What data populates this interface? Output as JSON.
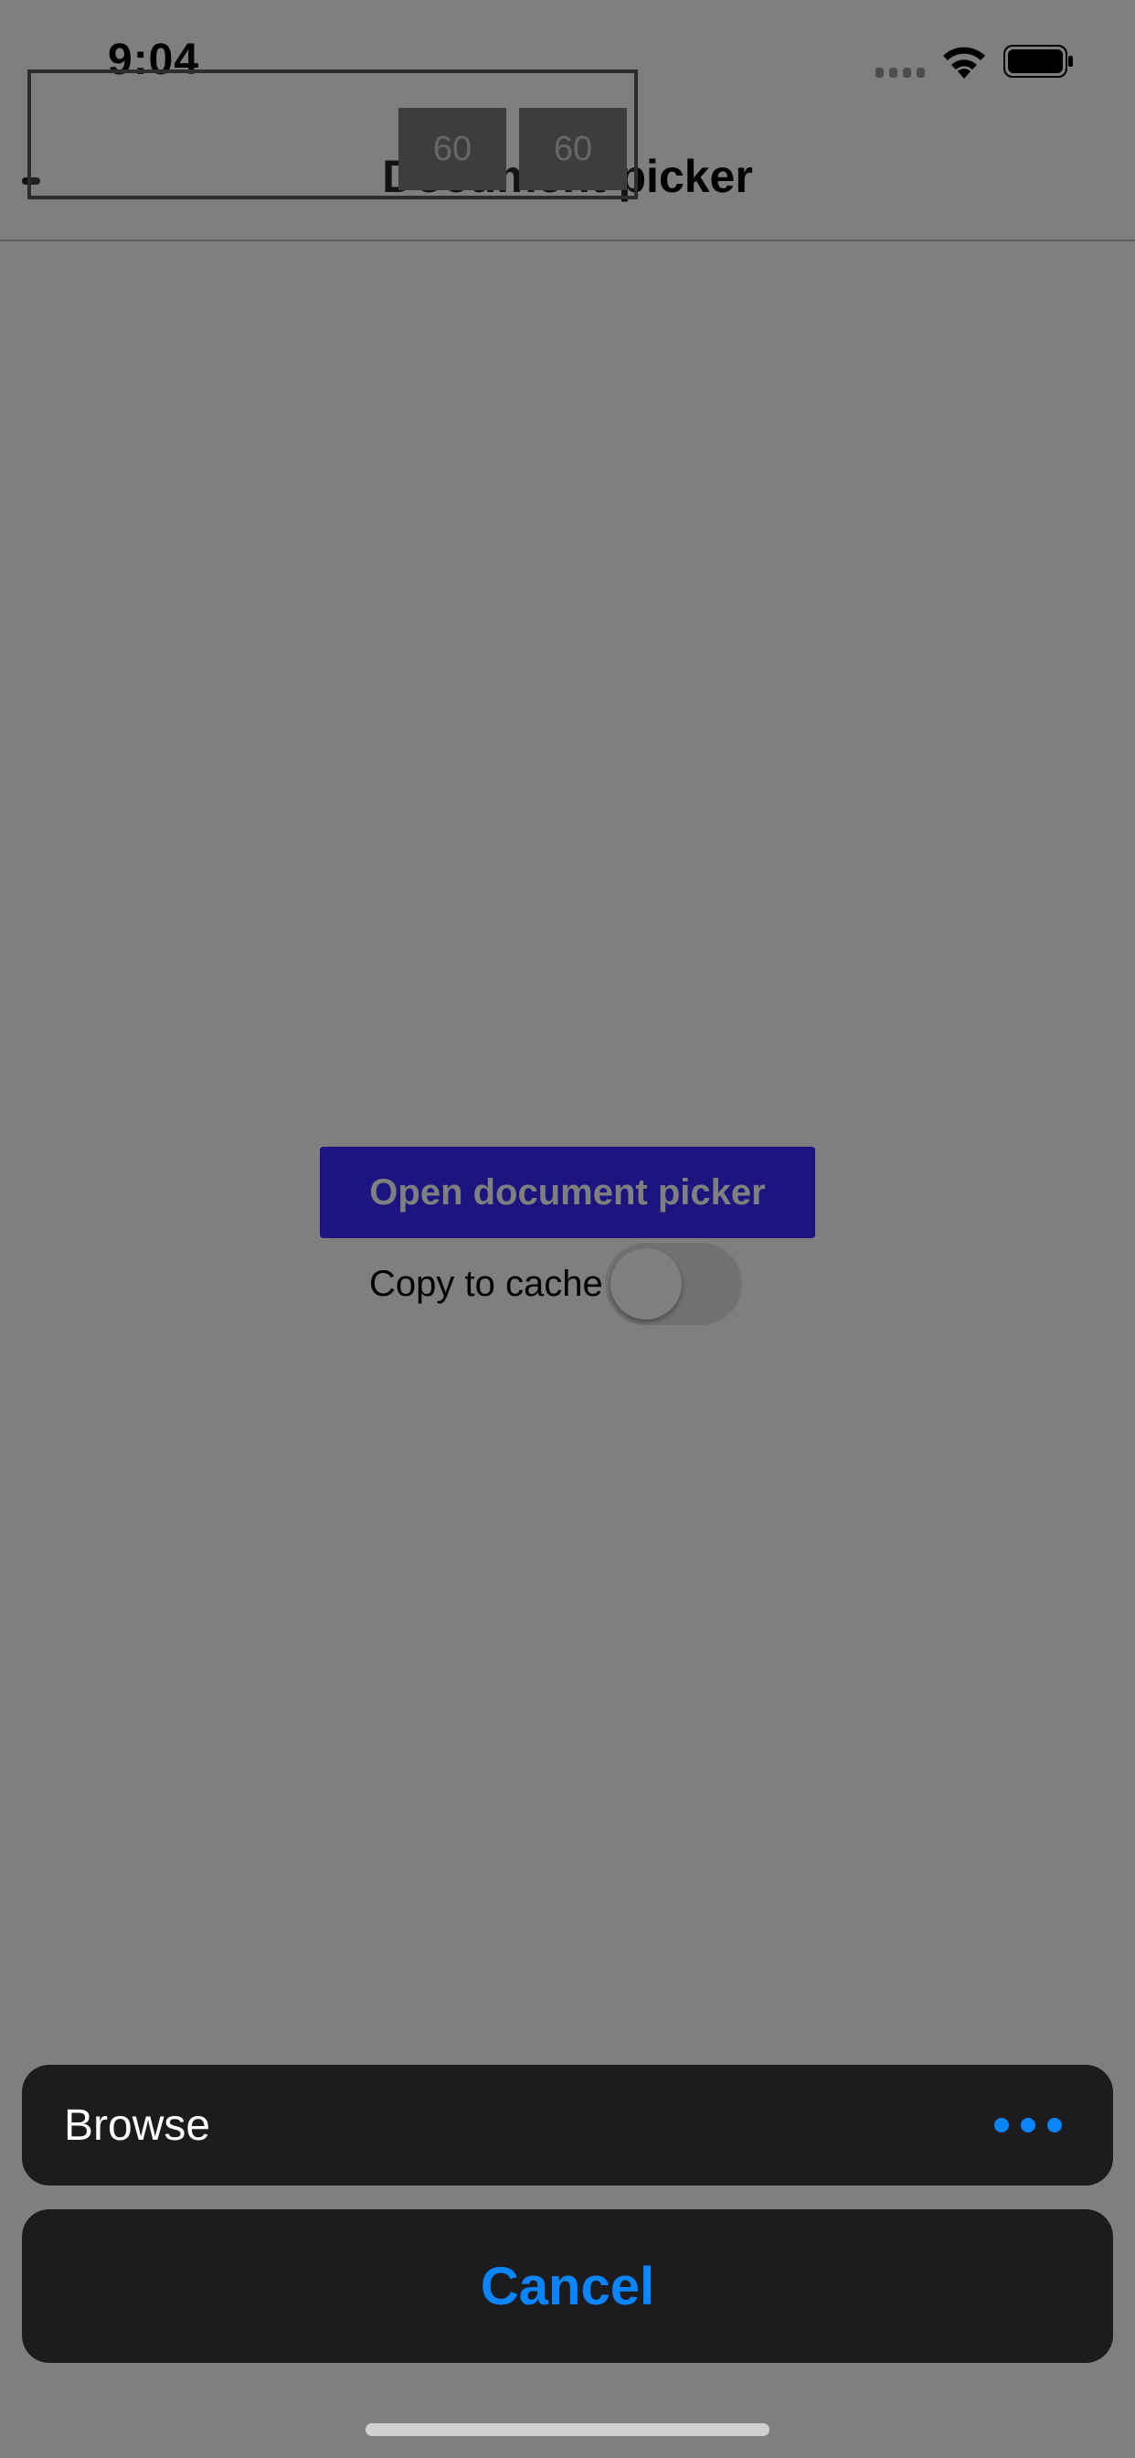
{
  "status_bar": {
    "time": "9:04",
    "icons": [
      "signal-icon",
      "wifi-icon",
      "battery-icon"
    ]
  },
  "nav": {
    "title": "Document picker"
  },
  "main": {
    "open_button_label": "Open document picker",
    "copy_label": "Copy to cache",
    "copy_toggle_on": false
  },
  "perf_monitor": {
    "values": [
      "60",
      "60"
    ]
  },
  "action_sheet": {
    "browse_label": "Browse",
    "more_icon": "more-horizontal-icon",
    "cancel_label": "Cancel"
  },
  "colors": {
    "primary_button": "#3a28ff",
    "sheet_background": "#1c1c1e",
    "accent_blue": "#0a84ff",
    "dim_overlay": "rgba(0,0,0,0.5)"
  }
}
